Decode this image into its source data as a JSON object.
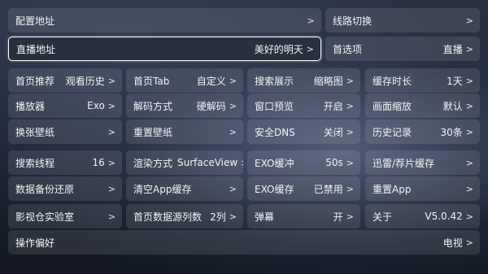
{
  "rows": [
    [
      {
        "label": "配置地址",
        "value": "",
        "arrow": ">"
      },
      {
        "label": "线路切换",
        "value": "",
        "arrow": ">"
      }
    ],
    [
      {
        "label": "直播地址",
        "value": "美好的明天",
        "arrow": ">"
      },
      {
        "label": "首选项",
        "value": "直播",
        "arrow": ">"
      }
    ],
    [
      {
        "label": "首页推荐",
        "value": "观看历史",
        "arrow": ">"
      },
      {
        "label": "首页Tab",
        "value": "自定义",
        "arrow": ">"
      },
      {
        "label": "搜索展示",
        "value": "缩略图",
        "arrow": ">"
      },
      {
        "label": "缓存时长",
        "value": "1天",
        "arrow": ">"
      }
    ],
    [
      {
        "label": "播放器",
        "value": "Exo",
        "arrow": ">"
      },
      {
        "label": "解码方式",
        "value": "硬解码",
        "arrow": ">"
      },
      {
        "label": "窗口预览",
        "value": "开启",
        "arrow": ">"
      },
      {
        "label": "画面缩放",
        "value": "默认",
        "arrow": ">"
      }
    ],
    [
      {
        "label": "换张壁纸",
        "value": "",
        "arrow": ">"
      },
      {
        "label": "重置壁纸",
        "value": "",
        "arrow": ">"
      },
      {
        "label": "安全DNS",
        "value": "关闭",
        "arrow": ">"
      },
      {
        "label": "历史记录",
        "value": "30条",
        "arrow": ">"
      }
    ],
    [
      {
        "label": "搜索线程",
        "value": "16",
        "arrow": ">"
      },
      {
        "label": "渲染方式",
        "value": "SurfaceView",
        "arrow": ">"
      },
      {
        "label": "EXO缓冲",
        "value": "50s",
        "arrow": ">"
      },
      {
        "label": "迅雷/荐片缓存",
        "value": "",
        "arrow": ">"
      }
    ],
    [
      {
        "label": "数据备份还原",
        "value": "",
        "arrow": ">"
      },
      {
        "label": "清空App缓存",
        "value": "",
        "arrow": ">"
      },
      {
        "label": "EXO缓存",
        "value": "已禁用",
        "arrow": ">"
      },
      {
        "label": "重置App",
        "value": "",
        "arrow": ">"
      }
    ],
    [
      {
        "label": "影视仓实验室",
        "value": "",
        "arrow": ">"
      },
      {
        "label": "首页数据源列数",
        "value": "2列",
        "arrow": ">"
      },
      {
        "label": "弹幕",
        "value": "开",
        "arrow": ">"
      },
      {
        "label": "关于",
        "value": "V5.0.42",
        "arrow": ">"
      }
    ],
    [
      {
        "label": "操作偏好",
        "value": "电视",
        "arrow": ">"
      }
    ]
  ]
}
